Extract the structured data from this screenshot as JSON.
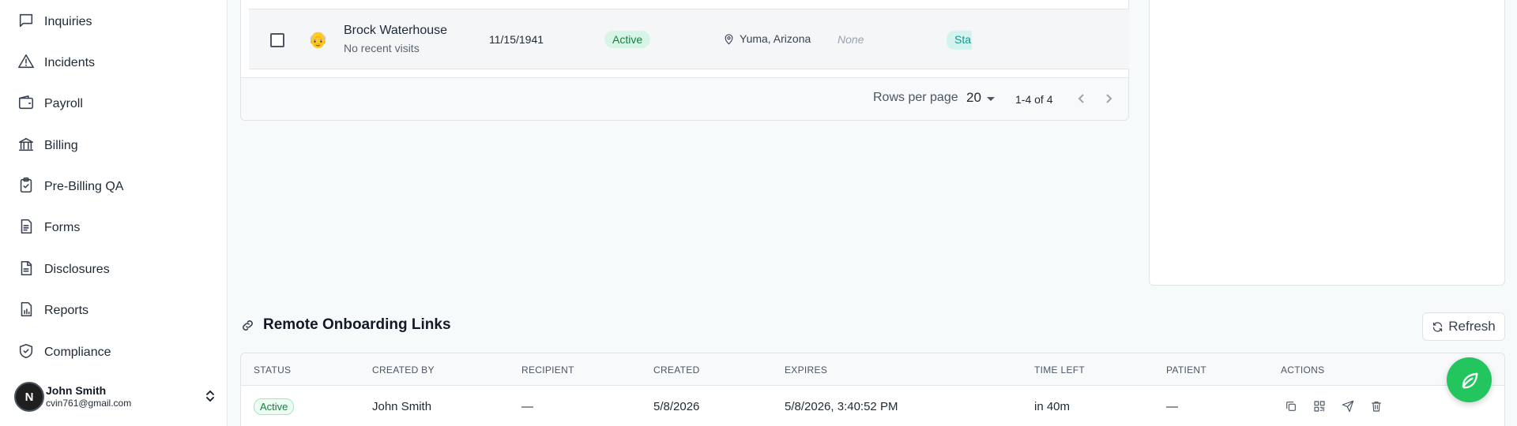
{
  "sidebar": {
    "items": [
      {
        "label": "Inquiries",
        "icon": "message-square-icon"
      },
      {
        "label": "Incidents",
        "icon": "alert-triangle-icon"
      },
      {
        "label": "Payroll",
        "icon": "wallet-icon"
      },
      {
        "label": "Billing",
        "icon": "bank-icon"
      },
      {
        "label": "Pre-Billing QA",
        "icon": "clipboard-check-icon"
      },
      {
        "label": "Forms",
        "icon": "form-icon"
      },
      {
        "label": "Disclosures",
        "icon": "file-text-icon"
      },
      {
        "label": "Reports",
        "icon": "report-chart-icon"
      },
      {
        "label": "Compliance",
        "icon": "shield-check-icon"
      }
    ],
    "user": {
      "initial": "N",
      "name": "John Smith",
      "email": "cvin761@gmail.com"
    }
  },
  "patients": {
    "row": {
      "name": "Brock Waterhouse",
      "subtitle": "No recent visits",
      "dob": "11/15/1941",
      "status": "Active",
      "location": "Yuma, Arizona",
      "none_value": "None",
      "status2": "Sta"
    },
    "footer": {
      "rows_per_page_label": "Rows per page",
      "rows_per_page_value": "20",
      "range": "1-4 of 4"
    }
  },
  "onboarding": {
    "title": "Remote Onboarding Links",
    "refresh_label": "Refresh",
    "columns": [
      "STATUS",
      "CREATED BY",
      "RECIPIENT",
      "CREATED",
      "EXPIRES",
      "TIME LEFT",
      "PATIENT",
      "ACTIONS"
    ],
    "row": {
      "status": "Active",
      "created_by": "John Smith",
      "recipient": "—",
      "created": "5/8/2026",
      "expires": "5/8/2026, 3:40:52 PM",
      "time_left": "in 40m",
      "patient": "—"
    }
  },
  "colors": {
    "accent_green": "#22c55e",
    "active_badge_bg": "#d7f5e7"
  }
}
